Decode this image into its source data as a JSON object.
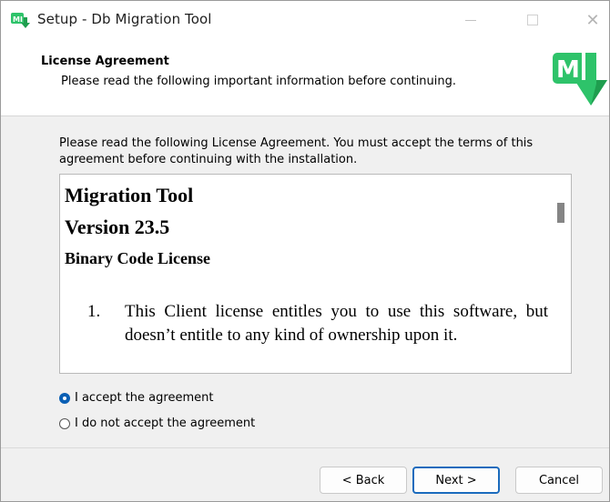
{
  "window": {
    "title": "Setup - Db Migration Tool",
    "controls": {
      "minimize_icon": "minimize-icon",
      "maximize_icon": "maximize-icon",
      "close_icon": "close-icon",
      "close_glyph": "✕"
    }
  },
  "header": {
    "title": "License Agreement",
    "subtitle": "Please read the following important information before continuing.",
    "logo_icon": "ml-logo-icon",
    "logo_text": "M"
  },
  "main": {
    "intro": "Please read the following License Agreement. You must accept the terms of this agreement before continuing with the installation.",
    "license": {
      "heading1": "Migration Tool",
      "heading2": "Version 23.5",
      "heading3": "Binary Code License",
      "items": [
        {
          "number": "1.",
          "text": "This Client license entitles you to use this software, but doesn’t entitle to any kind of ownership upon it."
        }
      ]
    },
    "options": [
      {
        "label": "I accept the agreement",
        "selected": true
      },
      {
        "label": "I do not accept the agreement",
        "selected": false
      }
    ]
  },
  "footer": {
    "back_label": "< Back",
    "next_label": "Next >",
    "cancel_label": "Cancel"
  },
  "colors": {
    "accent": "#0a5fb4",
    "logo_green": "#2ec36a",
    "logo_dark_green": "#1f9e4f"
  }
}
